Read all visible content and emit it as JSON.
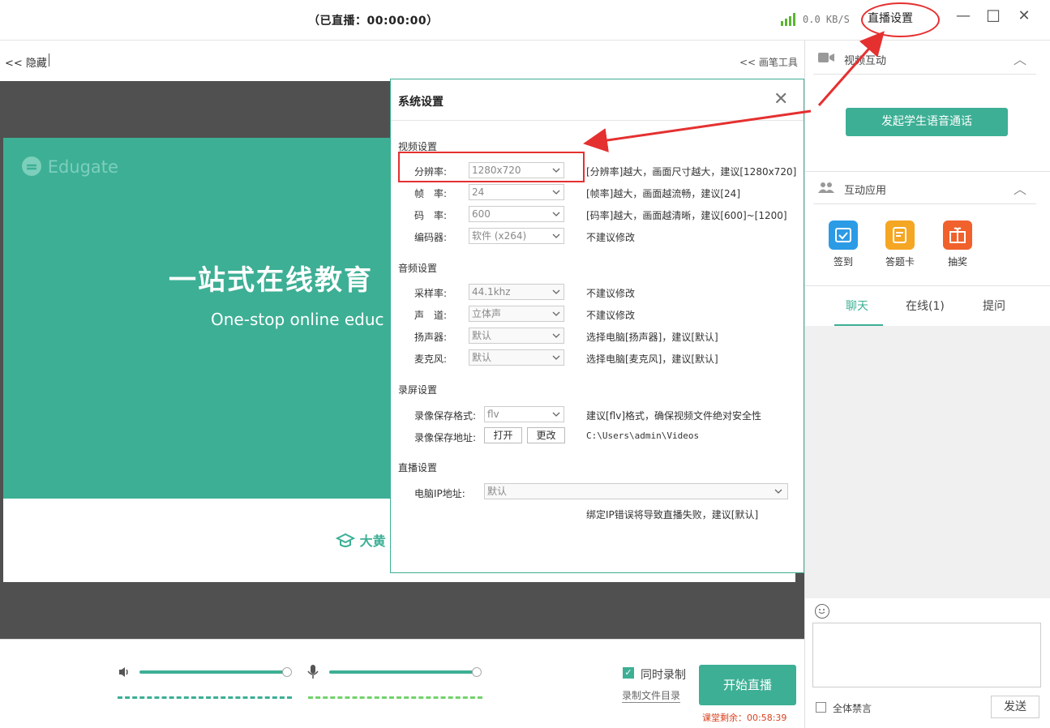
{
  "topbar": {
    "live_status": "（已直播：00:00:00）",
    "speed": "0.0 KB/S",
    "settings_label": "直播设置",
    "minimize": "—",
    "maximize": "☐",
    "close": "✕"
  },
  "left_header": {
    "hide_label": "<< 隐藏",
    "pen_tool_label": "<< 画笔工具"
  },
  "slide": {
    "logo_text": "Edugate",
    "title": "一站式在线教育",
    "subtitle": "One-stop online educ",
    "footer_logo": "大黄"
  },
  "bottom": {
    "speaker_volume_percent": 100,
    "mic_volume_percent": 100,
    "record_label": "同时录制",
    "record_dir_label": "录制文件目录",
    "start_label": "开始直播",
    "remaining": "课堂剩余：00:58:39"
  },
  "right": {
    "video_section": "视频互动",
    "voice_call": "发起学生语音通话",
    "apps_section": "互动应用",
    "apps": [
      {
        "label": "签到",
        "icon": "calendar-check-icon",
        "color": "#2b9be6"
      },
      {
        "label": "答题卡",
        "icon": "answer-card-icon",
        "color": "#f5a623"
      },
      {
        "label": "抽奖",
        "icon": "gift-icon",
        "color": "#f0612c"
      }
    ],
    "tabs": [
      "聊天",
      "在线(1)",
      "提问"
    ],
    "mute_all": "全体禁言",
    "send": "发送"
  },
  "dialog": {
    "title": "系统设置",
    "close": "✕",
    "video_group": "视频设置",
    "audio_group": "音频设置",
    "record_group": "录屏设置",
    "live_group": "直播设置",
    "rows": {
      "resolution": {
        "label": "分辨率:",
        "value": "1280x720",
        "hint": "[分辨率]越大，画面尺寸越大，建议[1280x720]"
      },
      "framerate": {
        "label": "帧　率:",
        "value": "24",
        "hint": "[帧率]越大，画面越流畅，建议[24]"
      },
      "bitrate": {
        "label": "码　率:",
        "value": "600",
        "hint": "[码率]越大，画面越清晰，建议[600]~[1200]"
      },
      "encoder": {
        "label": "编码器:",
        "value": "软件 (x264)",
        "hint": "不建议修改"
      },
      "samplerate": {
        "label": "采样率:",
        "value": "44.1khz",
        "hint": "不建议修改"
      },
      "channel": {
        "label": "声　道:",
        "value": "立体声",
        "hint": "不建议修改"
      },
      "speaker": {
        "label": "扬声器:",
        "value": "默认",
        "hint": "选择电脑[扬声器]，建议[默认]"
      },
      "mic": {
        "label": "麦克风:",
        "value": "默认",
        "hint": "选择电脑[麦克风]，建议[默认]"
      },
      "rec_format": {
        "label": "录像保存格式:",
        "value": "flv",
        "hint": "建议[flv]格式，确保视频文件绝对安全性"
      },
      "rec_path": {
        "label": "录像保存地址:",
        "open": "打开",
        "change": "更改",
        "hint": "C:\\Users\\admin\\Videos"
      },
      "ip": {
        "label": "电脑IP地址:",
        "value": "默认",
        "hint": "绑定IP错误将导致直播失败，建议[默认]"
      }
    }
  },
  "colors": {
    "accent": "#3daf95",
    "annotation": "#e53030",
    "warning": "#d9421f"
  }
}
